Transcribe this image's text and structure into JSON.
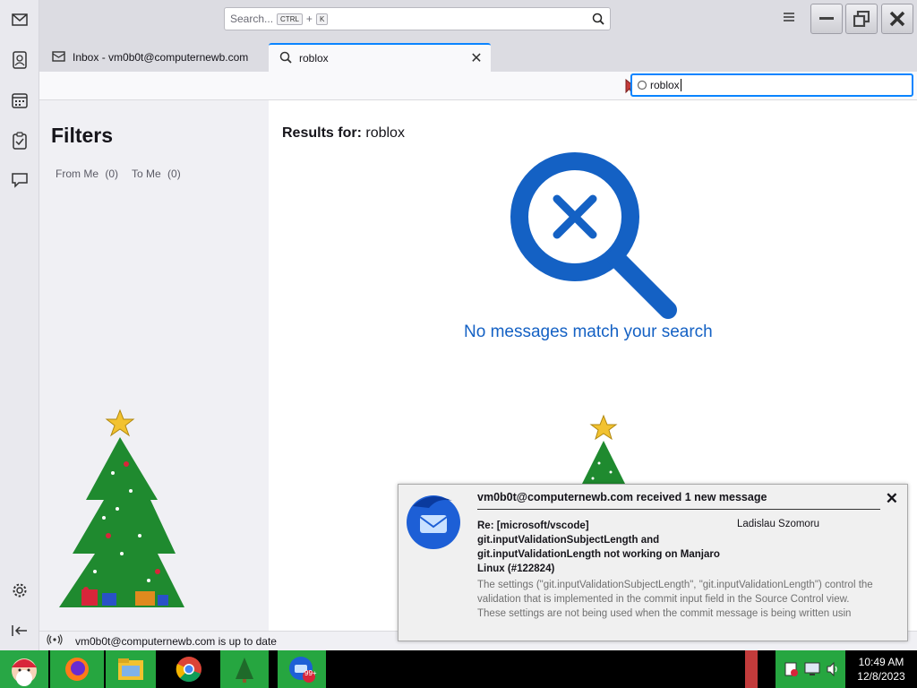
{
  "titlebar": {
    "search_placeholder": "Search...",
    "shortcut_ctrl": "CTRL",
    "shortcut_plus": "+",
    "shortcut_key": "K"
  },
  "tabs": [
    {
      "label": "Inbox - vm0b0t@computernewb.com",
      "icon": "mail-icon"
    },
    {
      "label": "roblox",
      "icon": "search-icon",
      "active": true
    }
  ],
  "quick_filter": {
    "value": "roblox"
  },
  "filters": {
    "title": "Filters",
    "items": [
      {
        "label": "From Me",
        "count": "(0)"
      },
      {
        "label": "To Me",
        "count": "(0)"
      }
    ]
  },
  "results": {
    "prefix": "Results for:",
    "query": "roblox",
    "empty_message": "No messages match your search"
  },
  "status": {
    "text": "vm0b0t@computernewb.com is up to date"
  },
  "notification": {
    "header": "vm0b0t@computernewb.com received 1 new message",
    "subject": "Re: [microsoft/vscode] git.inputValidationSubjectLength and git.inputValidationLength not working on Manjaro Linux (#122824)",
    "sender": "Ladislau Szomoru",
    "body": "The settings (\"git.inputValidationSubjectLength\", \"git.inputValidationLength\") control the validation that is implemented in the commit input field in the Source Control view. These settings are not being used when the commit message is being written usin"
  },
  "taskbar": {
    "time": "10:49 AM",
    "date": "12/8/2023",
    "badge": "99+"
  },
  "colors": {
    "accent": "#0a84ff",
    "empty_icon": "#1461c4",
    "taskbar_green": "#28a745"
  }
}
